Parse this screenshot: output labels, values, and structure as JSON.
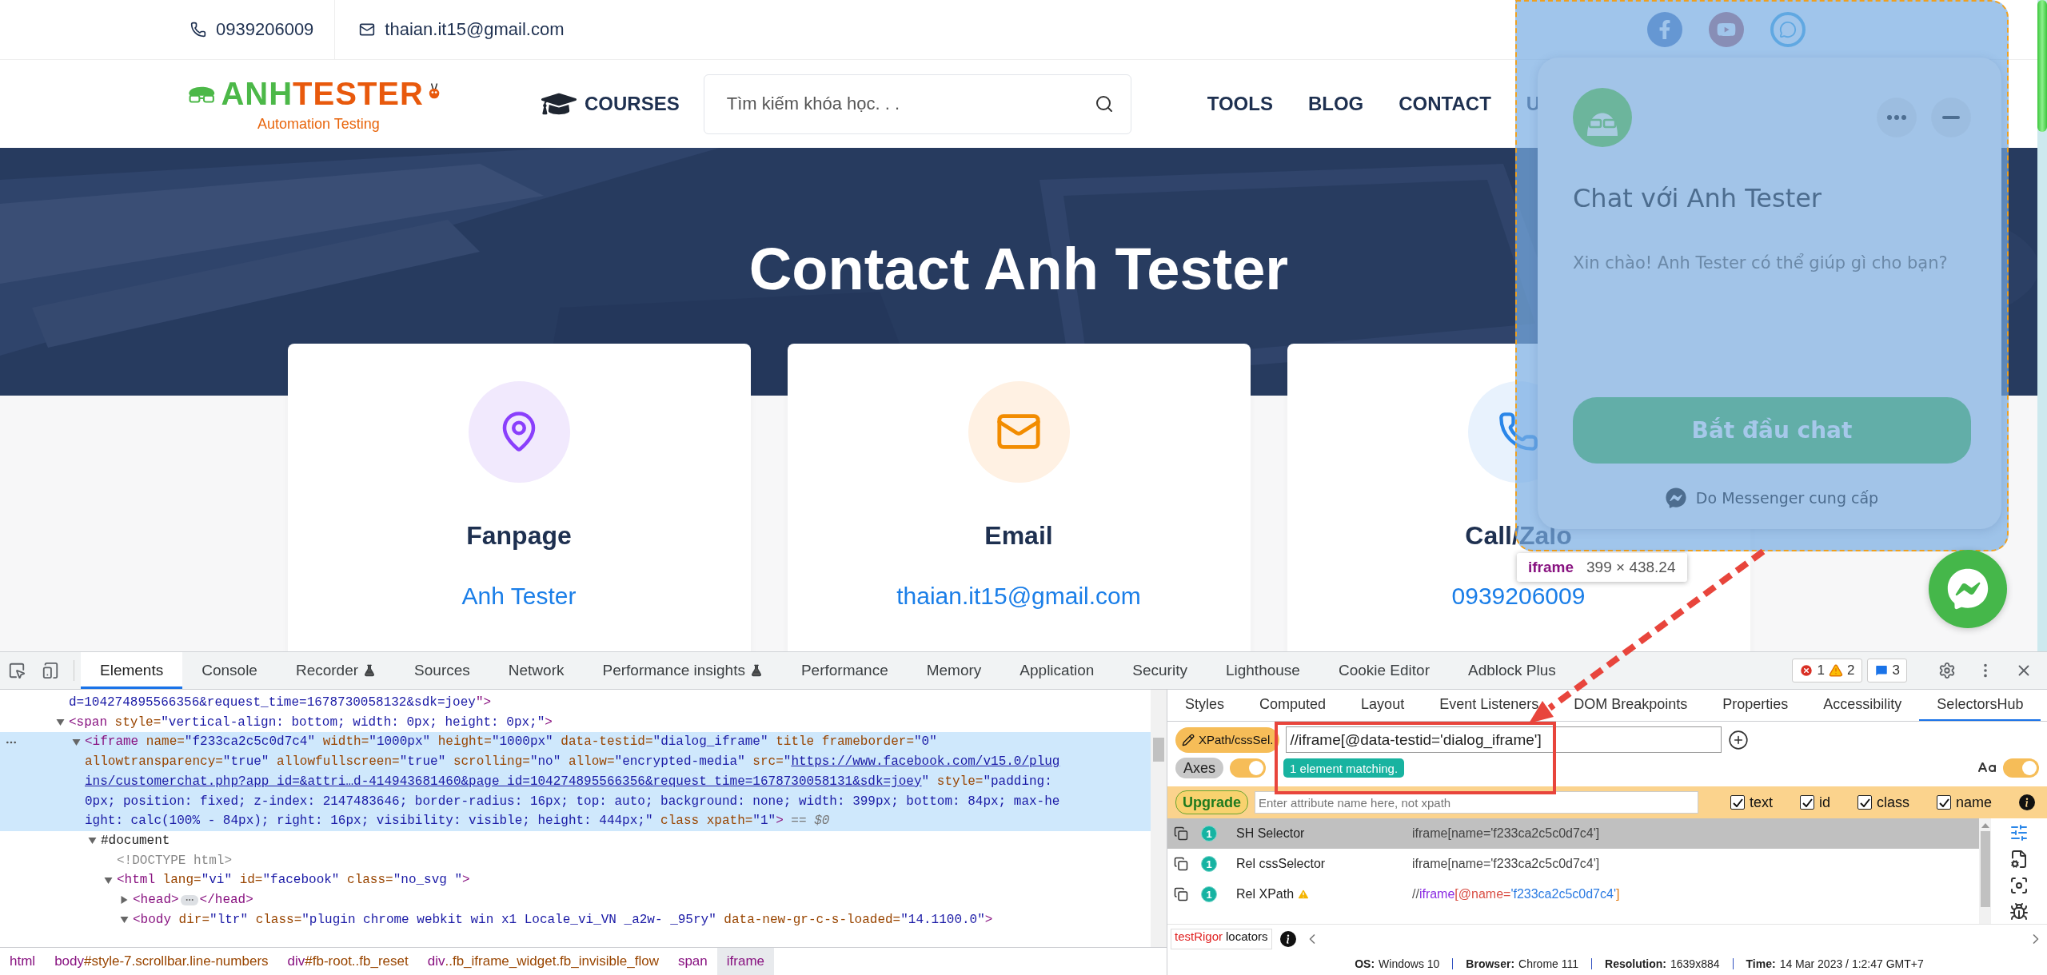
{
  "contact_bar": {
    "phone": "0939206009",
    "email": "thaian.it15@gmail.com"
  },
  "nav": {
    "logo": {
      "part1": "ANH",
      "part2": "TESTER",
      "tagline": "Automation Testing"
    },
    "courses": "COURSES",
    "search": {
      "placeholder": "Tìm kiếm khóa học. . ."
    },
    "links": [
      "TOOLS",
      "BLOG",
      "CONTACT",
      "U"
    ]
  },
  "hero": {
    "title": "Contact Anh Tester"
  },
  "cards": [
    {
      "kind": "pin",
      "title": "Fanpage",
      "link": "Anh Tester"
    },
    {
      "kind": "mail",
      "title": "Email",
      "link": "thaian.it15@gmail.com"
    },
    {
      "kind": "phone",
      "title": "Call/Zalo",
      "link": "0939206009"
    }
  ],
  "chat_widget": {
    "title": "Chat với Anh Tester",
    "greeting": "Xin chào! Anh Tester có thể giúp gì cho bạn?",
    "start_button": "Bắt đầu chat",
    "footer": "Do Messenger cung cấp"
  },
  "inspect_tooltip": {
    "tag": "iframe",
    "size": "399 × 438.24"
  },
  "devtools": {
    "tabs": [
      {
        "label": "Elements",
        "selected": true,
        "experimental": false
      },
      {
        "label": "Console",
        "selected": false,
        "experimental": false
      },
      {
        "label": "Recorder",
        "selected": false,
        "experimental": true
      },
      {
        "label": "Sources",
        "selected": false,
        "experimental": false
      },
      {
        "label": "Network",
        "selected": false,
        "experimental": false
      },
      {
        "label": "Performance insights",
        "selected": false,
        "experimental": true
      },
      {
        "label": "Performance",
        "selected": false,
        "experimental": false
      },
      {
        "label": "Memory",
        "selected": false,
        "experimental": false
      },
      {
        "label": "Application",
        "selected": false,
        "experimental": false
      },
      {
        "label": "Security",
        "selected": false,
        "experimental": false
      },
      {
        "label": "Lighthouse",
        "selected": false,
        "experimental": false
      },
      {
        "label": "Cookie Editor",
        "selected": false,
        "experimental": false
      },
      {
        "label": "Adblock Plus",
        "selected": false,
        "experimental": false
      }
    ],
    "issues": {
      "errors": "1",
      "warnings": "2",
      "messages": "3"
    },
    "elements_tree": [
      {
        "selected": false,
        "lines": [
          [
            {
              "kind": "value",
              "text": "d=104274895566356&request_time=1678730058132&sdk=joey"
            },
            {
              "kind": "tag",
              "text": "\">"
            }
          ]
        ]
      },
      {
        "expanded": true,
        "selected": false,
        "lines": [
          [
            {
              "kind": "tag",
              "text": "<span"
            },
            {
              "kind": "attr",
              "text": " style="
            },
            {
              "kind": "value",
              "text": "\"vertical-align: bottom; width: 0px; height: 0px;\""
            },
            {
              "kind": "tag",
              "text": ">"
            }
          ]
        ],
        "children": [
          {
            "expanded": true,
            "selected": true,
            "lines": [
              [
                {
                  "kind": "tag",
                  "text": "<iframe"
                },
                {
                  "kind": "attr",
                  "text": " name="
                },
                {
                  "kind": "value",
                  "text": "\"f233ca2c5c0d7c4\""
                },
                {
                  "kind": "attr",
                  "text": " width="
                },
                {
                  "kind": "value",
                  "text": "\"1000px\""
                },
                {
                  "kind": "attr",
                  "text": " height="
                },
                {
                  "kind": "value",
                  "text": "\"1000px\""
                },
                {
                  "kind": "attr",
                  "text": " data-testid="
                },
                {
                  "kind": "value",
                  "text": "\"dialog_iframe\""
                },
                {
                  "kind": "attr",
                  "text": " title frameborder="
                },
                {
                  "kind": "value",
                  "text": "\"0\""
                }
              ],
              [
                {
                  "kind": "attr",
                  "text": "allowtransparency="
                },
                {
                  "kind": "value",
                  "text": "\"true\""
                },
                {
                  "kind": "attr",
                  "text": " allowfullscreen="
                },
                {
                  "kind": "value",
                  "text": "\"true\""
                },
                {
                  "kind": "attr",
                  "text": " scrolling="
                },
                {
                  "kind": "value",
                  "text": "\"no\""
                },
                {
                  "kind": "attr",
                  "text": " allow="
                },
                {
                  "kind": "value",
                  "text": "\"encrypted-media\""
                },
                {
                  "kind": "attr",
                  "text": " src="
                },
                {
                  "kind": "value",
                  "text": "\""
                },
                {
                  "kind": "link",
                  "text": "https://www.facebook.com/v15.0/plug"
                }
              ],
              [
                {
                  "kind": "link",
                  "text": "ins/customerchat.php?app_id=&attri…d-414943681460&page_id=104274895566356&request_time=1678730058131&sdk=joey"
                },
                {
                  "kind": "value",
                  "text": "\""
                },
                {
                  "kind": "attr",
                  "text": " style="
                },
                {
                  "kind": "value",
                  "text": "\"padding:"
                }
              ],
              [
                {
                  "kind": "value",
                  "text": "0px; position: fixed; z-index: 2147483646; border-radius: 16px; top: auto; background: none; width: 399px; bottom: 84px; max-he"
                }
              ],
              [
                {
                  "kind": "value",
                  "text": "ight: calc(100% - 84px); right: 16px; visibility: visible; height: 444px;\""
                },
                {
                  "kind": "attr",
                  "text": " class xpath="
                },
                {
                  "kind": "value",
                  "text": "\"1\""
                },
                {
                  "kind": "tag",
                  "text": ">"
                },
                {
                  "kind": "dollar",
                  "text": " == $0"
                }
              ]
            ],
            "children": [
              {
                "expanded": true,
                "selected": false,
                "lines": [
                  [
                    {
                      "kind": "text",
                      "text": "#document"
                    }
                  ]
                ],
                "children": [
                  {
                    "selected": false,
                    "lines": [
                      [
                        {
                          "kind": "comment",
                          "text": "<!DOCTYPE html>"
                        }
                      ]
                    ]
                  },
                  {
                    "expanded": true,
                    "selected": false,
                    "lines": [
                      [
                        {
                          "kind": "tag",
                          "text": "<html"
                        },
                        {
                          "kind": "attr",
                          "text": " lang="
                        },
                        {
                          "kind": "value",
                          "text": "\"vi\""
                        },
                        {
                          "kind": "attr",
                          "text": " id="
                        },
                        {
                          "kind": "value",
                          "text": "\"facebook\""
                        },
                        {
                          "kind": "attr",
                          "text": " class="
                        },
                        {
                          "kind": "value",
                          "text": "\"no_svg \""
                        },
                        {
                          "kind": "tag",
                          "text": ">"
                        }
                      ]
                    ],
                    "children": [
                      {
                        "expanded": false,
                        "selected": false,
                        "lines": [
                          [
                            {
                              "kind": "tag",
                              "text": "<head>"
                            },
                            {
                              "kind": "ellipsis"
                            },
                            {
                              "kind": "tag",
                              "text": "</head>"
                            }
                          ]
                        ]
                      },
                      {
                        "expanded": true,
                        "selected": false,
                        "lines": [
                          [
                            {
                              "kind": "tag",
                              "text": "<body"
                            },
                            {
                              "kind": "attr",
                              "text": " dir="
                            },
                            {
                              "kind": "value",
                              "text": "\"ltr\""
                            },
                            {
                              "kind": "attr",
                              "text": " class="
                            },
                            {
                              "kind": "value",
                              "text": "\"plugin chrome webkit win x1 Locale_vi_VN _a2w- _95ry\""
                            },
                            {
                              "kind": "attr",
                              "text": " data-new-gr-c-s-loaded="
                            },
                            {
                              "kind": "value",
                              "text": "\"14.1100.0\""
                            },
                            {
                              "kind": "tag",
                              "text": ">"
                            }
                          ]
                        ]
                      }
                    ]
                  }
                ]
              }
            ]
          }
        ]
      }
    ],
    "breadcrumbs": [
      {
        "tag": "html",
        "selected": false
      },
      {
        "tag": "body",
        "suffix": "#style-7.scrollbar.line-numbers",
        "selected": false
      },
      {
        "tag": "div",
        "suffix": "#fb-root..fb_reset",
        "selected": false
      },
      {
        "tag": "div",
        "suffix": "..fb_iframe_widget.fb_invisible_flow",
        "selected": false
      },
      {
        "tag": "span",
        "selected": false
      },
      {
        "tag": "iframe",
        "selected": true
      }
    ],
    "sidebar_tabs": [
      {
        "label": "Styles",
        "selected": false
      },
      {
        "label": "Computed",
        "selected": false
      },
      {
        "label": "Layout",
        "selected": false
      },
      {
        "label": "Event Listeners",
        "selected": false
      },
      {
        "label": "DOM Breakpoints",
        "selected": false
      },
      {
        "label": "Properties",
        "selected": false
      },
      {
        "label": "Accessibility",
        "selected": false
      },
      {
        "label": "SelectorsHub",
        "selected": true
      }
    ],
    "selectors_hub": {
      "mode_button": "XPath/cssSel.",
      "selector_input": "//iframe[@data-testid='dialog_iframe']",
      "axes": {
        "label": "Axes",
        "on": true
      },
      "match_badge": "1 element matching.",
      "case_toggle": {
        "on": true
      },
      "upgrade_button": "Upgrade",
      "attribute_placeholder": "Enter attribute name here, not xpath",
      "filters": [
        {
          "label": "text",
          "checked": true
        },
        {
          "label": "id",
          "checked": true
        },
        {
          "label": "class",
          "checked": true
        },
        {
          "label": "name",
          "checked": true
        }
      ],
      "results": [
        {
          "count": "1",
          "name": "SH Selector",
          "warning": false,
          "selected": true,
          "value": [
            {
              "kind": "plain",
              "text": "iframe[name='f233ca2c5c0d7c4']"
            }
          ]
        },
        {
          "count": "1",
          "name": "Rel cssSelector",
          "warning": false,
          "selected": false,
          "value": [
            {
              "kind": "plain",
              "text": "iframe[name='f233ca2c5c0d7c4']"
            }
          ]
        },
        {
          "count": "1",
          "name": "Rel XPath",
          "warning": true,
          "selected": false,
          "value": [
            {
              "kind": "slash",
              "text": "//"
            },
            {
              "kind": "tag",
              "text": "iframe"
            },
            {
              "kind": "attr",
              "text": "[@name="
            },
            {
              "kind": "string",
              "text": "'f233ca2c5c0d7c4'"
            },
            {
              "kind": "bracket",
              "text": "]"
            }
          ]
        }
      ],
      "footer": {
        "brand": "testRigor",
        "label": "locators"
      },
      "status": [
        {
          "label": "OS:",
          "value": "Windows 10"
        },
        {
          "label": "Browser:",
          "value": "Chrome 111"
        },
        {
          "label": "Resolution:",
          "value": "1639x884"
        },
        {
          "label": "Time:",
          "value": "14 Mar 2023 / 1:2:47 GMT+7"
        }
      ]
    }
  }
}
